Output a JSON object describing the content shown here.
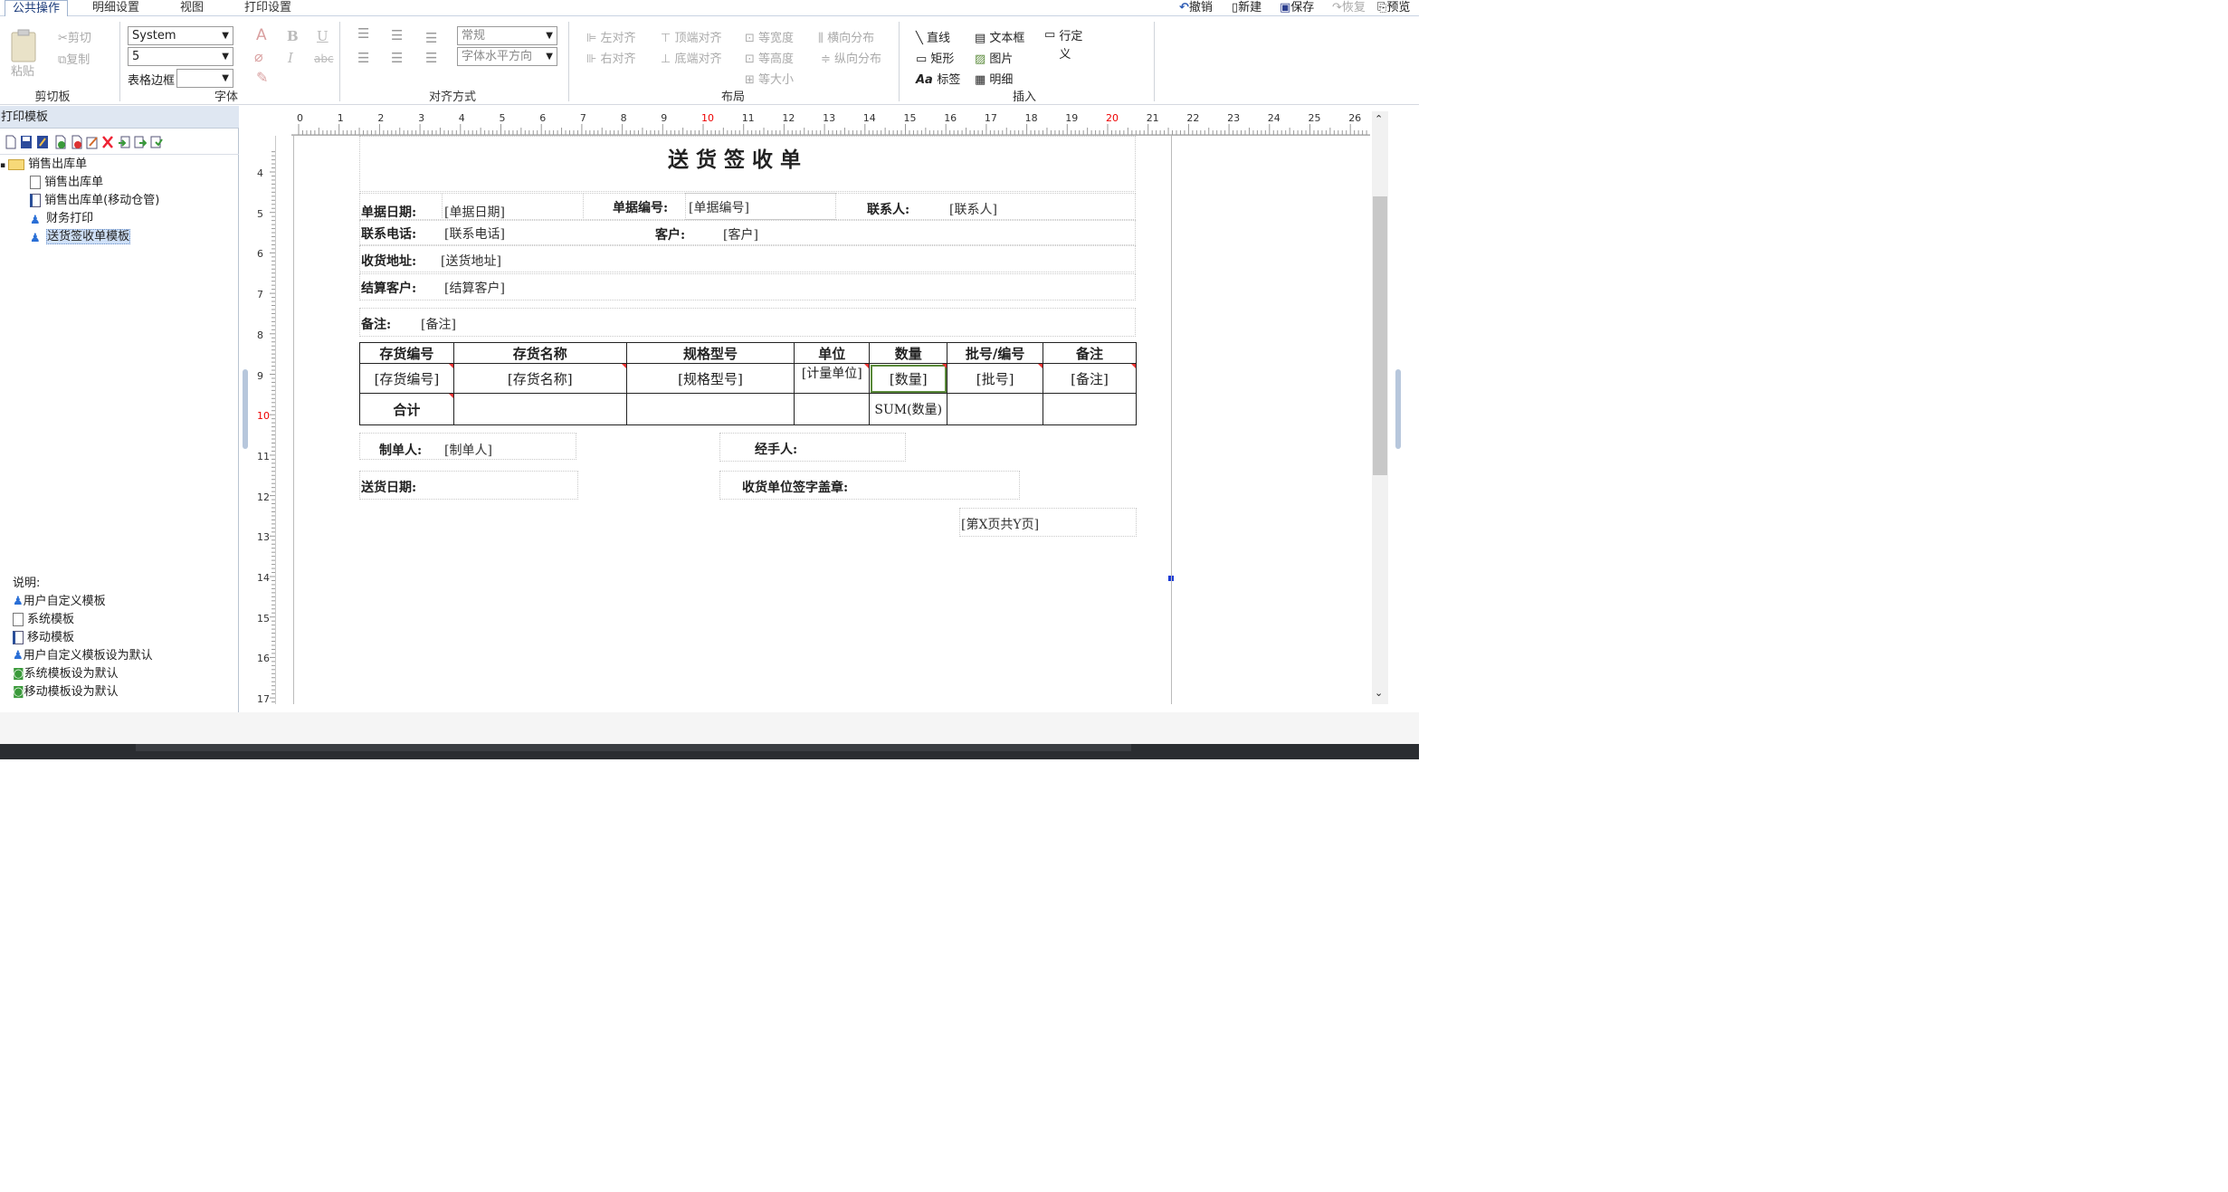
{
  "tabs": [
    "公共操作",
    "明细设置",
    "视图",
    "打印设置"
  ],
  "quick_actions": {
    "undo": "撤销",
    "new": "新建",
    "save": "保存",
    "redo": "恢复",
    "preview": "预览"
  },
  "ribbon": {
    "clipboard": {
      "label": "剪切板",
      "paste": "粘贴",
      "cut": "剪切",
      "copy": "复制"
    },
    "font": {
      "label": "字体",
      "family": "System",
      "size": "5",
      "border_label": "表格边框"
    },
    "align": {
      "label": "对齐方式",
      "style": "常规",
      "direction": "字体水平方向"
    },
    "layout": {
      "label": "布局",
      "left": "左对齐",
      "top": "顶端对齐",
      "equal_width": "等宽度",
      "h_dist": "横向分布",
      "right": "右对齐",
      "bottom": "底端对齐",
      "equal_height": "等高度",
      "v_dist": "纵向分布",
      "equal_size": "等大小"
    },
    "insert": {
      "label": "插入",
      "line": "直线",
      "textbox": "文本框",
      "row_def": "行定义",
      "rect": "矩形",
      "image": "图片",
      "label_item": "标签",
      "detail": "明细"
    }
  },
  "left_panel": {
    "title": "打印模板",
    "tree_root": "销售出库单",
    "tree_items": [
      "销售出库单",
      "销售出库单(移动仓管)",
      "财务打印",
      "送货签收单模板"
    ],
    "legend_title": "说明:",
    "legend": [
      "用户自定义模板",
      "系统模板",
      "移动模板",
      "用户自定义模板设为默认",
      "系统模板设为默认",
      "移动模板设为默认"
    ]
  },
  "ruler": {
    "h": [
      "0",
      "1",
      "2",
      "3",
      "4",
      "5",
      "6",
      "7",
      "8",
      "9",
      "10",
      "11",
      "12",
      "13",
      "14",
      "15",
      "16",
      "17",
      "18",
      "19",
      "20",
      "21",
      "22",
      "23",
      "24",
      "25",
      "26"
    ],
    "v": [
      "4",
      "5",
      "6",
      "7",
      "8",
      "9",
      "10",
      "11",
      "12",
      "13",
      "14",
      "15",
      "16",
      "17"
    ]
  },
  "doc": {
    "title": "送 货 签 收 单",
    "date_label": "单据日期:",
    "date_val": "[单据日期]",
    "no_label": "单据编号:",
    "no_val": "[单据编号]",
    "contact_label": "联系人:",
    "contact_val": "[联系人]",
    "phone_label": "联系电话:",
    "phone_val": "[联系电话]",
    "customer_label": "客户:",
    "customer_val": "[客户]",
    "addr_label": "收货地址:",
    "addr_val": "[送货地址]",
    "settle_label": "结算客户:",
    "settle_val": "[结算客户]",
    "remark_label": "备注:",
    "remark_val": "[备注]",
    "headers": [
      "存货编号",
      "存货名称",
      "规格型号",
      "单位",
      "数量",
      "批号/编号",
      "备注"
    ],
    "row": [
      "[存货编号]",
      "[存货名称]",
      "[规格型号]",
      "[计量单位]",
      "[数量]",
      "[批号]",
      "[备注]"
    ],
    "total_label": "合计",
    "total_qty": "SUM(数量)",
    "maker_label": "制单人:",
    "maker_val": "[制单人]",
    "handler_label": "经手人:",
    "ship_date_label": "送货日期:",
    "sign_label": "收货单位签字盖章:",
    "page_info": "[第X页共Y页]"
  }
}
